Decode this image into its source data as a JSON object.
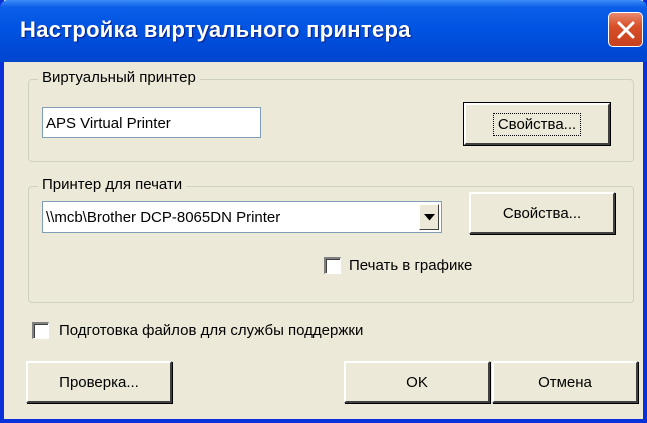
{
  "window": {
    "title": "Настройка виртуального принтера",
    "close_icon": "close-icon"
  },
  "virtual_printer_group": {
    "legend": "Виртуальный принтер",
    "printer_name": "APS Virtual Printer",
    "properties_label": "Свойства..."
  },
  "print_printer_group": {
    "legend": "Принтер для печати",
    "selected_printer": "\\\\mcb\\Brother DCP-8065DN Printer",
    "properties_label": "Свойства...",
    "print_graphics_label": "Печать в графике",
    "print_graphics_checked": false
  },
  "support_files": {
    "label": "Подготовка файлов для службы поддержки",
    "checked": false
  },
  "buttons": {
    "test_label": "Проверка...",
    "ok_label": "OK",
    "cancel_label": "Отмена"
  },
  "colors": {
    "titlebar": "#0054e3",
    "window_border": "#0831d9",
    "dialog_bg": "#ece9d8",
    "close_button": "#d8502a"
  }
}
